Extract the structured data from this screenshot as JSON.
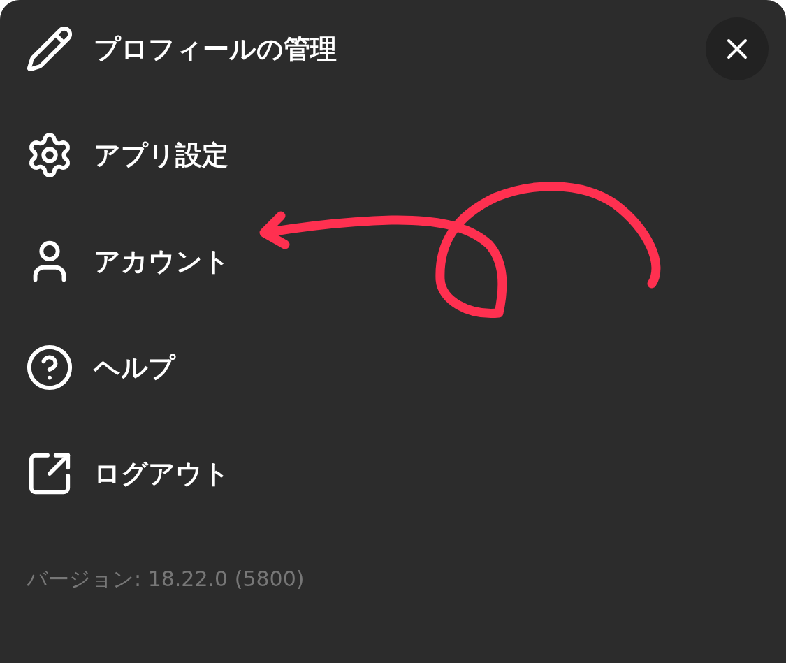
{
  "menu": {
    "items": [
      {
        "label": "プロフィールの管理"
      },
      {
        "label": "アプリ設定"
      },
      {
        "label": "アカウント"
      },
      {
        "label": "ヘルプ"
      },
      {
        "label": "ログアウト"
      }
    ]
  },
  "version": "バージョン: 18.22.0 (5800)"
}
